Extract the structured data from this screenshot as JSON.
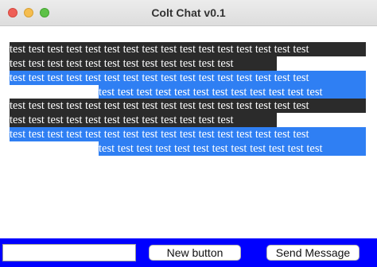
{
  "window": {
    "title": "Colt Chat v0.1"
  },
  "messages": [
    {
      "style": "dark",
      "lines": [
        "test test test test test test test test test test test test test test test test",
        "test test test test test test test test test test test test"
      ]
    },
    {
      "style": "blue",
      "lines": [
        "test test test test test test test test test test test test test test test test",
        "test test test test test test test test test test test test"
      ]
    },
    {
      "style": "dark",
      "lines": [
        "test test test test test test test test test test test test test test test test",
        "test test test test test test test test test test test test"
      ]
    },
    {
      "style": "blue",
      "lines": [
        "test test test test test test test test test test test test test test test test",
        "test test test test test test test test test test test test"
      ]
    }
  ],
  "bottom": {
    "input_value": "",
    "new_button_label": "New button",
    "send_button_label": "Send Message"
  },
  "colors": {
    "dark_message_bg": "#2b2b2b",
    "blue_message_bg": "#2f7ff3",
    "bottom_bar_bg": "#0000ff"
  }
}
